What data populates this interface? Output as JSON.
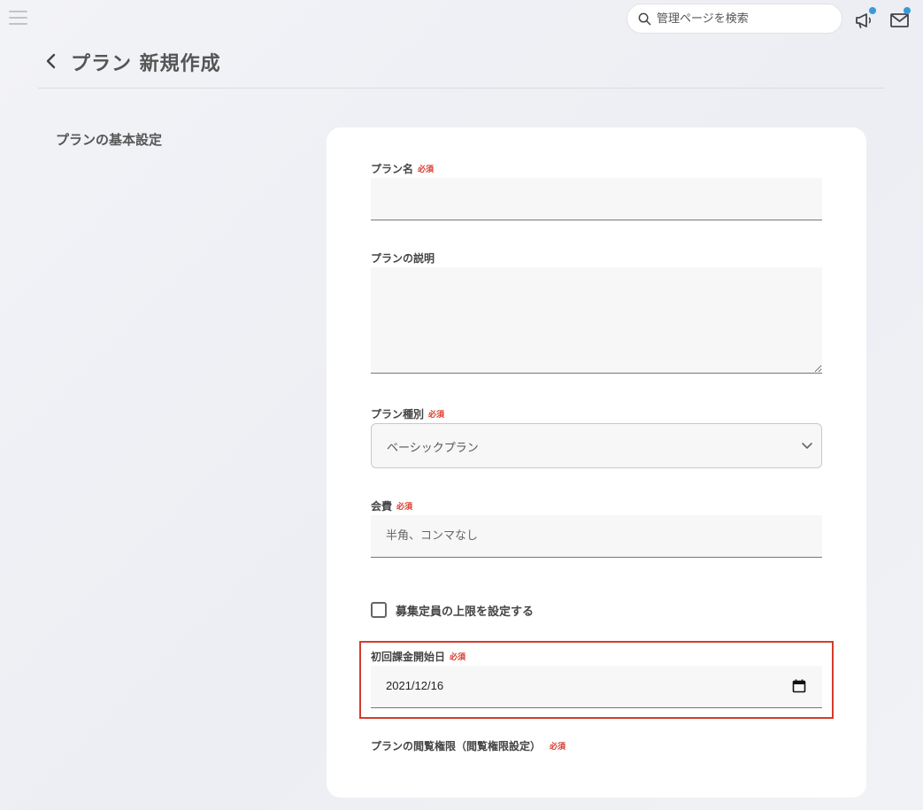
{
  "header": {
    "search": {
      "placeholder": "管理ページを検索"
    },
    "icons": [
      "menu-icon",
      "search-icon",
      "megaphone-icon",
      "mail-icon"
    ],
    "notification_dot_color": "#3a9ad9"
  },
  "page": {
    "back_icon": "chevron-left-icon",
    "title": "プラン 新規作成",
    "section_title": "プランの基本設定"
  },
  "form": {
    "required_text": "必須",
    "required_color": "#d9392b",
    "plan_name": {
      "label": "プラン名",
      "value": ""
    },
    "description": {
      "label": "プランの説明",
      "value": ""
    },
    "plan_type": {
      "label": "プラン種別",
      "selected": "ベーシックプラン"
    },
    "fee": {
      "label": "会費",
      "placeholder": "半角、コンマなし"
    },
    "capacity_checkbox": {
      "label": "募集定員の上限を設定する",
      "checked": false
    },
    "start_date": {
      "label": "初回課金開始日",
      "value": "2021/12/16",
      "highlight_color": "#d33c2d"
    },
    "access": {
      "label": "プランの閲覧権限（閲覧権限設定）"
    }
  }
}
